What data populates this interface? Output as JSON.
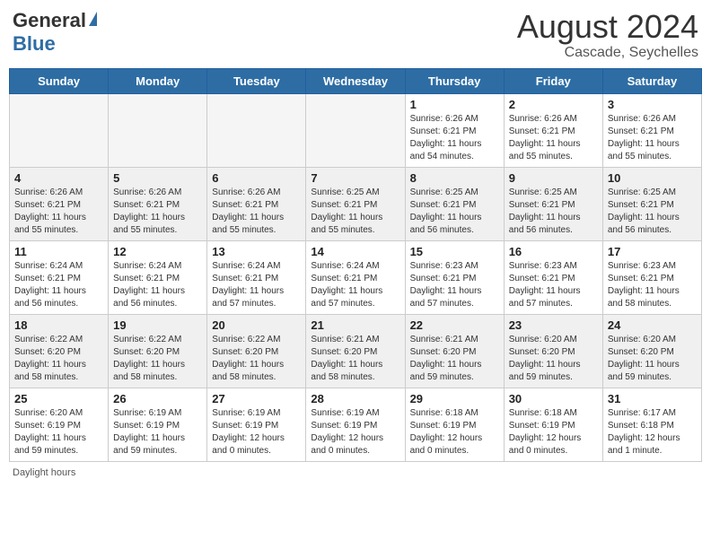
{
  "header": {
    "logo_general": "General",
    "logo_blue": "Blue",
    "month_year": "August 2024",
    "location": "Cascade, Seychelles"
  },
  "footer": {
    "daylight_label": "Daylight hours"
  },
  "days_of_week": [
    "Sunday",
    "Monday",
    "Tuesday",
    "Wednesday",
    "Thursday",
    "Friday",
    "Saturday"
  ],
  "weeks": [
    [
      {
        "day": "",
        "empty": true
      },
      {
        "day": "",
        "empty": true
      },
      {
        "day": "",
        "empty": true
      },
      {
        "day": "",
        "empty": true
      },
      {
        "day": "1",
        "sunrise": "6:26 AM",
        "sunset": "6:21 PM",
        "daylight": "11 hours and 54 minutes."
      },
      {
        "day": "2",
        "sunrise": "6:26 AM",
        "sunset": "6:21 PM",
        "daylight": "11 hours and 55 minutes."
      },
      {
        "day": "3",
        "sunrise": "6:26 AM",
        "sunset": "6:21 PM",
        "daylight": "11 hours and 55 minutes."
      }
    ],
    [
      {
        "day": "4",
        "sunrise": "6:26 AM",
        "sunset": "6:21 PM",
        "daylight": "11 hours and 55 minutes."
      },
      {
        "day": "5",
        "sunrise": "6:26 AM",
        "sunset": "6:21 PM",
        "daylight": "11 hours and 55 minutes."
      },
      {
        "day": "6",
        "sunrise": "6:26 AM",
        "sunset": "6:21 PM",
        "daylight": "11 hours and 55 minutes."
      },
      {
        "day": "7",
        "sunrise": "6:25 AM",
        "sunset": "6:21 PM",
        "daylight": "11 hours and 55 minutes."
      },
      {
        "day": "8",
        "sunrise": "6:25 AM",
        "sunset": "6:21 PM",
        "daylight": "11 hours and 56 minutes."
      },
      {
        "day": "9",
        "sunrise": "6:25 AM",
        "sunset": "6:21 PM",
        "daylight": "11 hours and 56 minutes."
      },
      {
        "day": "10",
        "sunrise": "6:25 AM",
        "sunset": "6:21 PM",
        "daylight": "11 hours and 56 minutes."
      }
    ],
    [
      {
        "day": "11",
        "sunrise": "6:24 AM",
        "sunset": "6:21 PM",
        "daylight": "11 hours and 56 minutes."
      },
      {
        "day": "12",
        "sunrise": "6:24 AM",
        "sunset": "6:21 PM",
        "daylight": "11 hours and 56 minutes."
      },
      {
        "day": "13",
        "sunrise": "6:24 AM",
        "sunset": "6:21 PM",
        "daylight": "11 hours and 57 minutes."
      },
      {
        "day": "14",
        "sunrise": "6:24 AM",
        "sunset": "6:21 PM",
        "daylight": "11 hours and 57 minutes."
      },
      {
        "day": "15",
        "sunrise": "6:23 AM",
        "sunset": "6:21 PM",
        "daylight": "11 hours and 57 minutes."
      },
      {
        "day": "16",
        "sunrise": "6:23 AM",
        "sunset": "6:21 PM",
        "daylight": "11 hours and 57 minutes."
      },
      {
        "day": "17",
        "sunrise": "6:23 AM",
        "sunset": "6:21 PM",
        "daylight": "11 hours and 58 minutes."
      }
    ],
    [
      {
        "day": "18",
        "sunrise": "6:22 AM",
        "sunset": "6:20 PM",
        "daylight": "11 hours and 58 minutes."
      },
      {
        "day": "19",
        "sunrise": "6:22 AM",
        "sunset": "6:20 PM",
        "daylight": "11 hours and 58 minutes."
      },
      {
        "day": "20",
        "sunrise": "6:22 AM",
        "sunset": "6:20 PM",
        "daylight": "11 hours and 58 minutes."
      },
      {
        "day": "21",
        "sunrise": "6:21 AM",
        "sunset": "6:20 PM",
        "daylight": "11 hours and 58 minutes."
      },
      {
        "day": "22",
        "sunrise": "6:21 AM",
        "sunset": "6:20 PM",
        "daylight": "11 hours and 59 minutes."
      },
      {
        "day": "23",
        "sunrise": "6:20 AM",
        "sunset": "6:20 PM",
        "daylight": "11 hours and 59 minutes."
      },
      {
        "day": "24",
        "sunrise": "6:20 AM",
        "sunset": "6:20 PM",
        "daylight": "11 hours and 59 minutes."
      }
    ],
    [
      {
        "day": "25",
        "sunrise": "6:20 AM",
        "sunset": "6:19 PM",
        "daylight": "11 hours and 59 minutes."
      },
      {
        "day": "26",
        "sunrise": "6:19 AM",
        "sunset": "6:19 PM",
        "daylight": "11 hours and 59 minutes."
      },
      {
        "day": "27",
        "sunrise": "6:19 AM",
        "sunset": "6:19 PM",
        "daylight": "12 hours and 0 minutes."
      },
      {
        "day": "28",
        "sunrise": "6:19 AM",
        "sunset": "6:19 PM",
        "daylight": "12 hours and 0 minutes."
      },
      {
        "day": "29",
        "sunrise": "6:18 AM",
        "sunset": "6:19 PM",
        "daylight": "12 hours and 0 minutes."
      },
      {
        "day": "30",
        "sunrise": "6:18 AM",
        "sunset": "6:19 PM",
        "daylight": "12 hours and 0 minutes."
      },
      {
        "day": "31",
        "sunrise": "6:17 AM",
        "sunset": "6:18 PM",
        "daylight": "12 hours and 1 minute."
      }
    ]
  ]
}
